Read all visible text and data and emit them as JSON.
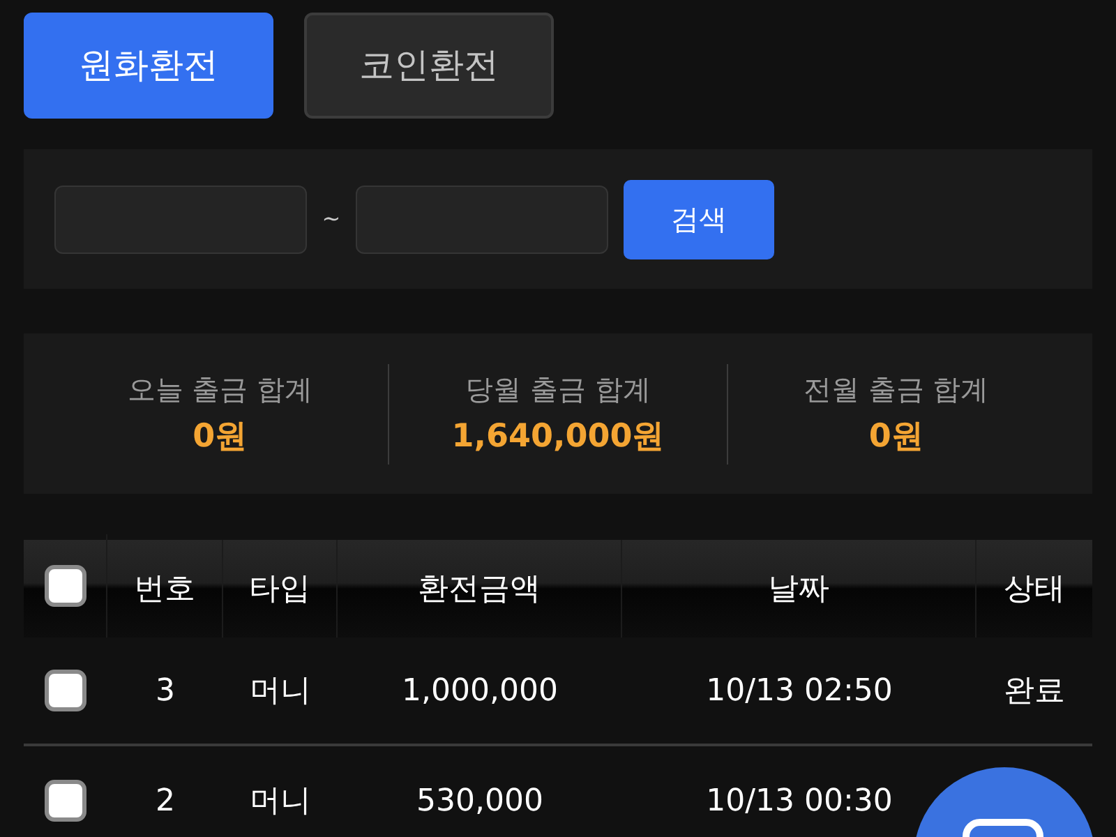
{
  "tabs": [
    {
      "label": "원화환전",
      "selected": true
    },
    {
      "label": "코인환전",
      "selected": false
    }
  ],
  "search": {
    "separator": "~",
    "button": "검색"
  },
  "summary": [
    {
      "label": "오늘 출금 합계",
      "value": "0원"
    },
    {
      "label": "당월 출금 합계",
      "value": "1,640,000원"
    },
    {
      "label": "전월 출금 합계",
      "value": "0원"
    }
  ],
  "table": {
    "select_all": {
      "checked": false
    },
    "columns": [
      "번호",
      "타입",
      "환전금액",
      "날짜",
      "상태"
    ],
    "rows": [
      {
        "checked": false,
        "cells": [
          "3",
          "머니",
          "1,000,000",
          "10/13 02:50",
          "완료"
        ]
      },
      {
        "checked": false,
        "cells": [
          "2",
          "머니",
          "530,000",
          "10/13 00:30"
        ]
      }
    ]
  }
}
